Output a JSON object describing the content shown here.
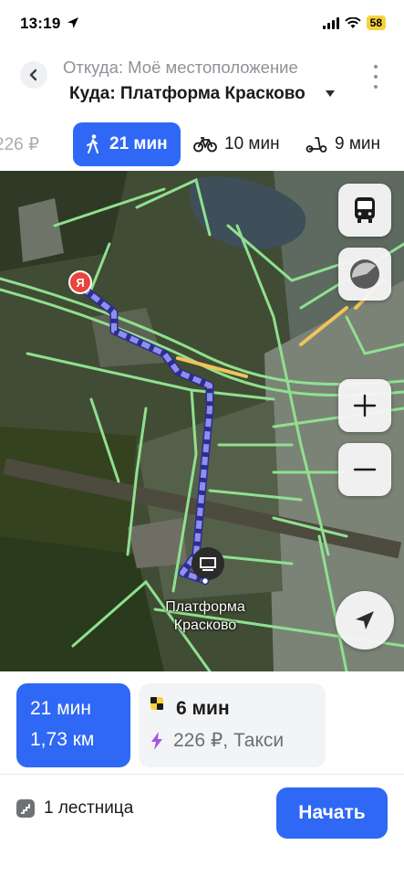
{
  "status_bar": {
    "time": "13:19",
    "battery": "58"
  },
  "header": {
    "from": "Откуда: Моё местоположение",
    "to": "Куда: Платформа Красково"
  },
  "mode_tabs": {
    "taxi_price": "226 ₽",
    "walk_time": "21 мин",
    "bike_time": "10 мин",
    "scooter_time": "9 мин"
  },
  "map": {
    "destination_name_line1": "Платформа",
    "destination_name_line2": "Красково",
    "start_marker_letter": "Я"
  },
  "route_card": {
    "walk_time": "21 мин",
    "distance": "1,73 км",
    "taxi_time": "6 мин",
    "taxi_price": "226 ₽, Такси"
  },
  "footer": {
    "stairs_text": "1 лестница",
    "start_button": "Начать"
  },
  "colors": {
    "accent": "#2f68f5",
    "route": "#7f7fe0",
    "roads": "#8fe08f",
    "traffic": "#f2c35a"
  }
}
